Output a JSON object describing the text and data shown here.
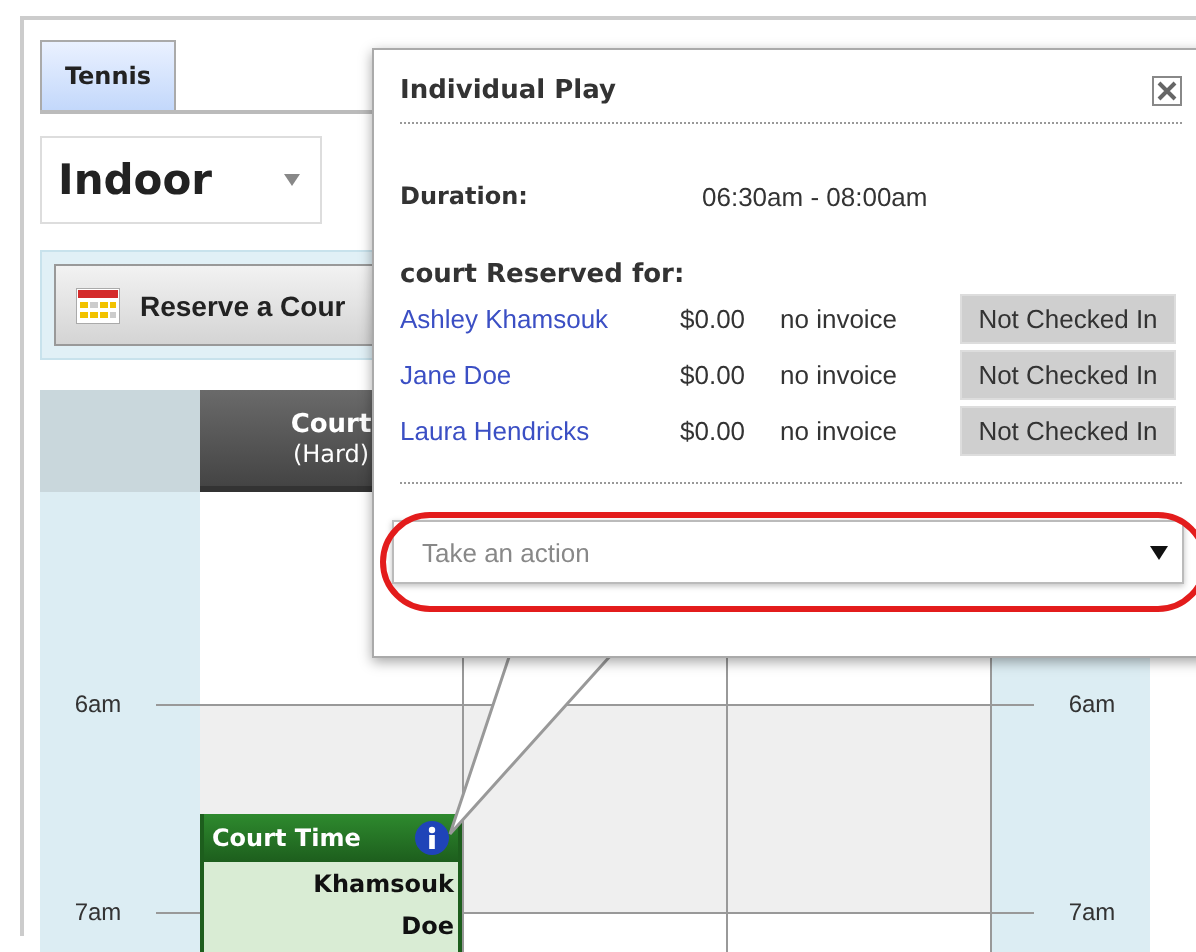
{
  "tabs": [
    {
      "label": "Tennis",
      "selected": true
    }
  ],
  "location_select": {
    "value": "Indoor"
  },
  "toolbar": {
    "reserve_button": "Reserve a Cour"
  },
  "courts": [
    {
      "name": "Court",
      "surface": "(Hard)"
    }
  ],
  "left_times": [
    "6am",
    "7am"
  ],
  "right_times": [
    "6am",
    "7am"
  ],
  "booking": {
    "title": "Court Time",
    "players": [
      "Khamsouk",
      "Doe"
    ]
  },
  "popup": {
    "title": "Individual Play",
    "duration_label": "Duration:",
    "duration": "06:30am - 08:00am",
    "reserved_heading": "court Reserved for:",
    "players": [
      {
        "name": "Ashley Khamsouk",
        "amount": "$0.00",
        "invoice": "no invoice",
        "status": "Not Checked In"
      },
      {
        "name": "Jane Doe",
        "amount": "$0.00",
        "invoice": "no invoice",
        "status": "Not Checked In"
      },
      {
        "name": "Laura Hendricks",
        "amount": "$0.00",
        "invoice": "no invoice",
        "status": "Not Checked In"
      }
    ],
    "action_select": {
      "placeholder": "Take an action"
    }
  }
}
